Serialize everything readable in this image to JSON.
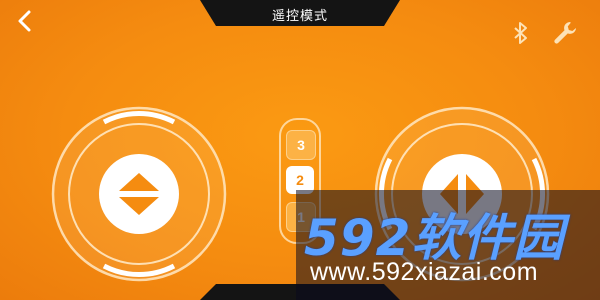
{
  "header": {
    "title": "遥控模式"
  },
  "icons": {
    "back": "back-chevron-icon",
    "bluetooth": "bluetooth-icon",
    "settings": "wrench-icon",
    "left_knob": "up-down-arrows-icon",
    "right_knob": "left-right-arrows-icon"
  },
  "gears": {
    "top": "3",
    "middle": "2",
    "bottom": "1",
    "selected": "2"
  },
  "watermark": {
    "logo": "592软件园",
    "url": "www.592xiazai.com"
  },
  "colors": {
    "background": "#f58c10",
    "accent": "#ffffff",
    "bar": "#141414"
  }
}
